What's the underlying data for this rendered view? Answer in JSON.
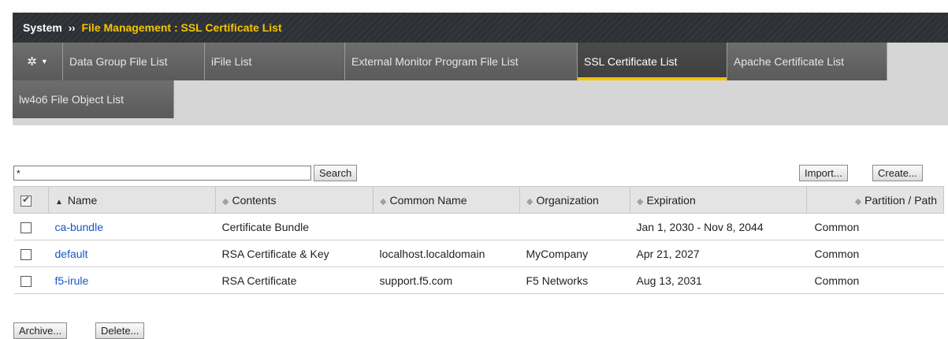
{
  "breadcrumb": {
    "root": "System",
    "separator": "››",
    "path": "File Management : SSL Certificate List"
  },
  "tabs": [
    {
      "label": "Data Group File List"
    },
    {
      "label": "iFile List"
    },
    {
      "label": "External Monitor Program File List"
    },
    {
      "label": "SSL Certificate List",
      "active": true
    },
    {
      "label": "Apache Certificate List"
    },
    {
      "label": "lw4o6 File Object List"
    }
  ],
  "search": {
    "value": "*",
    "button": "Search"
  },
  "actions": {
    "import": "Import...",
    "create": "Create..."
  },
  "table": {
    "columns": [
      "Name",
      "Contents",
      "Common Name",
      "Organization",
      "Expiration",
      "Partition / Path"
    ],
    "rows": [
      {
        "name": "ca-bundle",
        "contents": "Certificate Bundle",
        "common_name": "",
        "organization": "",
        "expiration": "Jan 1, 2030 - Nov 8, 2044",
        "partition": "Common"
      },
      {
        "name": "default",
        "contents": "RSA Certificate & Key",
        "common_name": "localhost.localdomain",
        "organization": "MyCompany",
        "expiration": "Apr 21, 2027",
        "partition": "Common"
      },
      {
        "name": "f5-irule",
        "contents": "RSA Certificate",
        "common_name": "support.f5.com",
        "organization": "F5 Networks",
        "expiration": "Aug 13, 2031",
        "partition": "Common"
      }
    ]
  },
  "footer": {
    "archive": "Archive...",
    "delete": "Delete..."
  },
  "colors": {
    "accent": "#f5c400",
    "link": "#1a55c8",
    "header_bg": "#33373b"
  }
}
